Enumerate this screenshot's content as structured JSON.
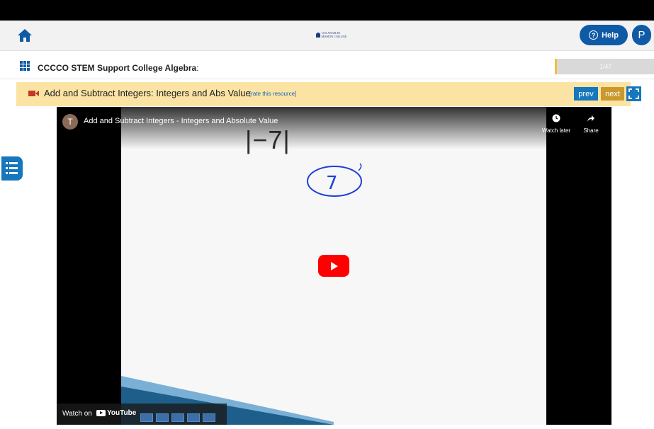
{
  "header": {
    "logo_text": "LOS ANGELES MISSION COLLEGE",
    "help_label": "Help",
    "profile_initial": "P"
  },
  "course": {
    "title": "CCCCO STEM Support College Algebra",
    "title_suffix": ":",
    "progress": "1/47"
  },
  "resource": {
    "title": "Add and Subtract Integers: Integers and Abs Value",
    "rate_link": "[rate this resource]",
    "prev_label": "prev",
    "next_label": "next"
  },
  "video": {
    "channel_initial": "T",
    "title": "Add and Subtract Integers - Integers and Absolute Value",
    "watch_later_label": "Watch later",
    "share_label": "Share",
    "expression": "|−7|",
    "circled_value": "7",
    "watch_on_label": "Watch on",
    "youtube_label": "YouTube"
  },
  "colors": {
    "brand_blue": "#0f5aa6",
    "resource_bar": "#fbe3a4",
    "next_gold": "#c9992e",
    "youtube_red": "#ff0000",
    "ink_blue": "#1d3fd6"
  }
}
